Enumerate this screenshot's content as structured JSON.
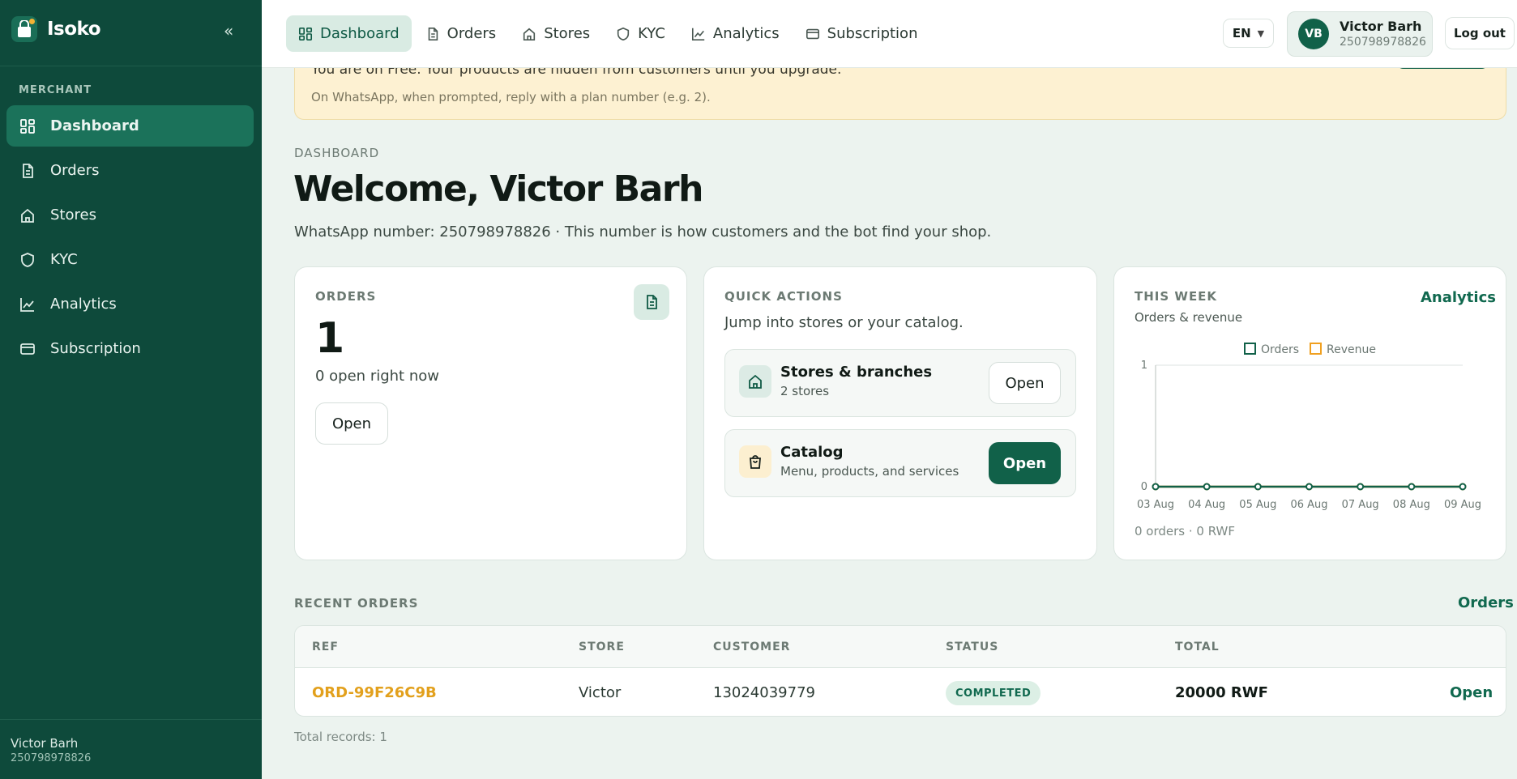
{
  "app": {
    "name": "Isoko"
  },
  "sidebar": {
    "section": "MERCHANT",
    "items": [
      {
        "label": "Dashboard",
        "icon": "grid-icon",
        "active": true
      },
      {
        "label": "Orders",
        "icon": "document-icon"
      },
      {
        "label": "Stores",
        "icon": "home-icon"
      },
      {
        "label": "KYC",
        "icon": "shield-icon"
      },
      {
        "label": "Analytics",
        "icon": "chart-line-icon"
      },
      {
        "label": "Subscription",
        "icon": "card-icon"
      }
    ],
    "user_name": "Victor Barh",
    "user_phone": "250798978826"
  },
  "topnav": {
    "tabs": [
      {
        "label": "Dashboard",
        "active": true
      },
      {
        "label": "Orders"
      },
      {
        "label": "Stores"
      },
      {
        "label": "KYC"
      },
      {
        "label": "Analytics"
      },
      {
        "label": "Subscription"
      }
    ],
    "language": "EN",
    "user": {
      "initials": "VB",
      "name": "Victor Barh",
      "phone": "250798978826"
    },
    "logout_label": "Log out"
  },
  "banner": {
    "text": "You are on Free. Your products are hidden from customers until you upgrade.",
    "subtext": "On WhatsApp, when prompted, reply with a plan number (e.g. 2)."
  },
  "page": {
    "breadcrumb": "DASHBOARD",
    "title": "Welcome, Victor Barh",
    "subtitle": "WhatsApp number: 250798978826 · This number is how customers and the bot find your shop."
  },
  "orders_card": {
    "label": "ORDERS",
    "count": "1",
    "subtext": "0 open right now",
    "button": "Open"
  },
  "quick_actions": {
    "label": "QUICK ACTIONS",
    "subtext": "Jump into stores or your catalog.",
    "items": [
      {
        "title": "Stores & branches",
        "desc": "2 stores",
        "button": "Open"
      },
      {
        "title": "Catalog",
        "desc": "Menu, products, and services",
        "button": "Open"
      }
    ]
  },
  "week_card": {
    "label": "THIS WEEK",
    "subtitle": "Orders & revenue",
    "link": "Analytics",
    "footer": "0 orders · 0 RWF"
  },
  "chart_data": {
    "type": "line",
    "title": "",
    "categories": [
      "03 Aug",
      "04 Aug",
      "05 Aug",
      "06 Aug",
      "07 Aug",
      "08 Aug",
      "09 Aug"
    ],
    "series": [
      {
        "name": "Orders",
        "values": [
          0,
          0,
          0,
          0,
          0,
          0,
          0
        ],
        "color": "#116149"
      },
      {
        "name": "Revenue",
        "values": [
          0,
          0,
          0,
          0,
          0,
          0,
          0
        ],
        "color": "#f0a020"
      }
    ],
    "ylim": [
      0,
      1
    ],
    "yticks": [
      "0",
      "1"
    ],
    "grid": true,
    "legend": "top"
  },
  "recent_orders": {
    "label": "RECENT ORDERS",
    "link": "Orders",
    "columns": [
      "REF",
      "STORE",
      "CUSTOMER",
      "STATUS",
      "TOTAL"
    ],
    "rows": [
      {
        "ref": "ORD-99F26C9B",
        "store": "Victor",
        "customer": "13024039779",
        "status": "COMPLETED",
        "total": "20000 RWF",
        "action": "Open"
      }
    ],
    "footer": "Total records: 1"
  },
  "colors": {
    "sidebar": "#0e4a3b",
    "accent": "#116149",
    "ref": "#e2a01c",
    "banner": "#fdf1d2"
  }
}
